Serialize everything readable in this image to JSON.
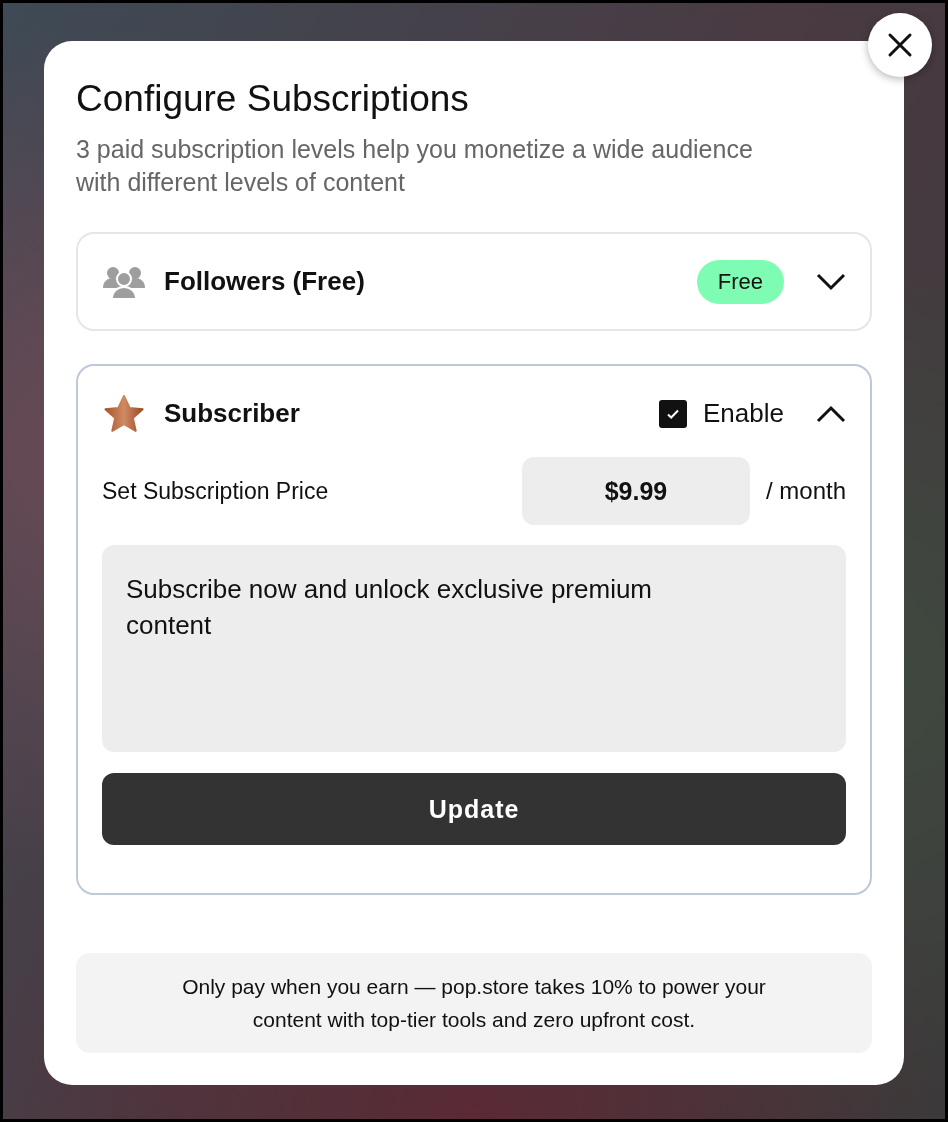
{
  "dialog": {
    "title": "Configure Subscriptions",
    "subtitle": "3 paid subscription levels help you monetize a wide audience with different levels of content"
  },
  "tiers": [
    {
      "kind": "free",
      "name": "Followers (Free)",
      "badge": "Free",
      "expanded": false
    },
    {
      "kind": "paid",
      "name": "Subscriber",
      "enable_label": "Enable",
      "enabled": true,
      "expanded": true,
      "price_label": "Set Subscription Price",
      "price": "$9.99",
      "period": "/ month",
      "description": "Subscribe now and unlock exclusive premium content",
      "button": "Update"
    }
  ],
  "footer_note": "Only pay when you earn — pop.store takes 10% to power your content with top-tier tools and zero upfront cost."
}
